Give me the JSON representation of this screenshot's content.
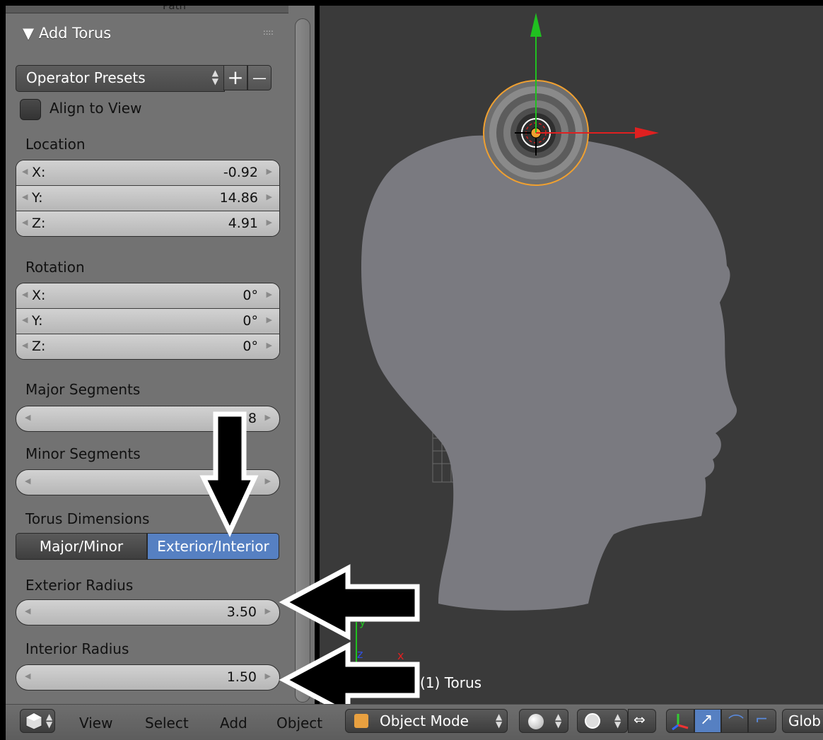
{
  "panel": {
    "top_clipped": "Path",
    "title": "▼ Add Torus",
    "grip": "::::",
    "presets_label": "Operator Presets",
    "presets_add": "+",
    "presets_remove": "—",
    "align_to_view": "Align to View",
    "location": {
      "heading": "Location",
      "rows": [
        {
          "axis": "X:",
          "value": "-0.92"
        },
        {
          "axis": "Y:",
          "value": "14.86"
        },
        {
          "axis": "Z:",
          "value": "4.91"
        }
      ]
    },
    "rotation": {
      "heading": "Rotation",
      "rows": [
        {
          "axis": "X:",
          "value": "0°"
        },
        {
          "axis": "Y:",
          "value": "0°"
        },
        {
          "axis": "Z:",
          "value": "0°"
        }
      ]
    },
    "major_segments": {
      "heading": "Major Segments",
      "value": "8"
    },
    "minor_segments": {
      "heading": "Minor Segments",
      "value": ""
    },
    "torus_dimensions": {
      "heading": "Torus Dimensions",
      "option_a": "Major/Minor",
      "option_b": "Exterior/Interior",
      "selected": "Exterior/Interior"
    },
    "exterior_radius": {
      "heading": "Exterior Radius",
      "value": "3.50"
    },
    "interior_radius": {
      "heading": "Interior Radius",
      "value": "1.50"
    }
  },
  "viewport": {
    "object_label": "(1) Torus",
    "axis_y": "y",
    "axis_z": "z",
    "axis_x": "x"
  },
  "header_bar": {
    "view": "View",
    "select": "Select",
    "add": "Add",
    "object": "Object",
    "mode": "Object Mode",
    "orientation": "Glob"
  },
  "colors": {
    "panel_bg": "#727272",
    "viewport_bg": "#3a3a3a",
    "head_fill": "#7a7a80",
    "selected_blue": "#5680c2",
    "selection_orange": "#f0a030"
  },
  "icons": [
    "cube-icon",
    "sphere-shading-icon",
    "pivot-icon",
    "snap-icon",
    "manipulator-axes-icon",
    "translate-icon",
    "rotate-icon",
    "scale-icon",
    "left-arrow-icon",
    "down-arrow-icon"
  ]
}
